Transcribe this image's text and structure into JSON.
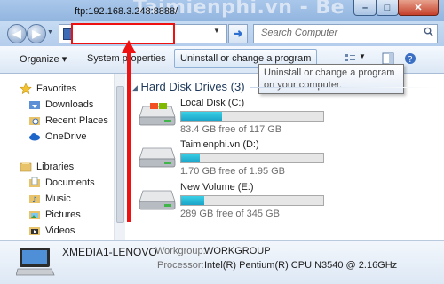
{
  "window": {
    "watermark": "Taimienphi.vn - Be",
    "controls": {
      "minimize": "–",
      "maximize": "□",
      "close": "✕"
    }
  },
  "address_bar": {
    "value": "ftp:192.168.3.248:8888/",
    "search_placeholder": "Search Computer",
    "icons": {
      "back": "back-arrow-icon",
      "forward": "forward-arrow-icon",
      "go": "go-arrow-icon",
      "search": "magnifier-icon"
    }
  },
  "toolbar": {
    "organize": "Organize ▾",
    "system_properties": "System properties",
    "uninstall": "Uninstall or change a program"
  },
  "tooltip": "Uninstall or change a program on your computer.",
  "nav": {
    "favorites": "Favorites",
    "downloads": "Downloads",
    "recent_places": "Recent Places",
    "onedrive": "OneDrive",
    "libraries": "Libraries",
    "documents": "Documents",
    "music": "Music",
    "pictures": "Pictures",
    "videos": "Videos"
  },
  "main": {
    "group_title": "Hard Disk Drives (3)",
    "drives": [
      {
        "name": "Local Disk (C:)",
        "space": "83.4 GB free of 117 GB",
        "used_fraction": 0.29
      },
      {
        "name": "Taimienphi.vn (D:)",
        "space": "1.70 GB free of 1.95 GB",
        "used_fraction": 0.13
      },
      {
        "name": "New Volume (E:)",
        "space": "289 GB free of 345 GB",
        "used_fraction": 0.16
      }
    ]
  },
  "details": {
    "computer_name": "XMEDIA1-LENOVO",
    "workgroup_label": "Workgroup:",
    "workgroup_value": "WORKGROUP",
    "processor_label": "Processor:",
    "processor_value": "Intel(R) Pentium(R) CPU  N3540 @ 2.16GHz"
  },
  "colors": {
    "highlight_red": "#ee1111",
    "drive_bar": "#1ba4c8"
  }
}
